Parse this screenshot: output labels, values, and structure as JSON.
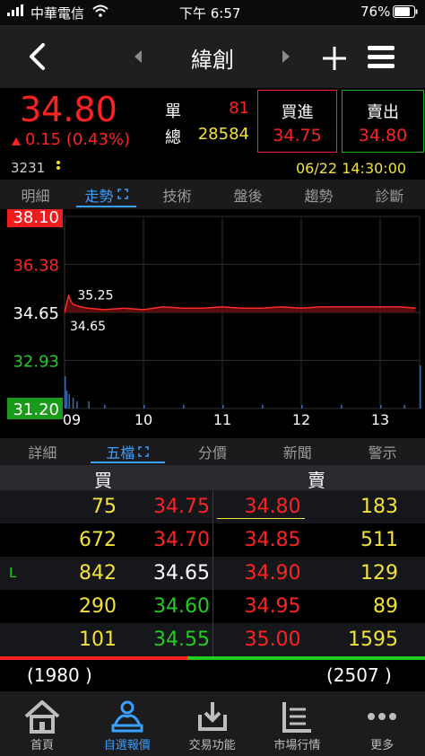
{
  "status_bar": {
    "carrier": "中華電信",
    "time": "下午 6:57",
    "battery": "76%"
  },
  "nav": {
    "title": "緯創",
    "back_icon": "chevron-left-icon",
    "prev_icon": "caret-left-icon",
    "next_icon": "caret-right-icon",
    "add_icon": "plus-icon",
    "menu_icon": "hamburger-icon"
  },
  "quote": {
    "price": "34.80",
    "change": "0.15 (0.43%)",
    "code": "3231",
    "single_label": "單",
    "single_value": "81",
    "total_label": "總",
    "total_value": "28584",
    "buy_label": "買進",
    "buy_price": "34.75",
    "sell_label": "賣出",
    "sell_price": "34.80",
    "datetime": "06/22 14:30:00"
  },
  "top_tabs": [
    "明細",
    "走勢",
    "技術",
    "盤後",
    "趨勢",
    "診斷"
  ],
  "top_tabs_active": 1,
  "chart_data": {
    "type": "line",
    "y_ticks": [
      "38.10",
      "36.38",
      "34.65",
      "32.93",
      "31.20"
    ],
    "ylim": [
      31.2,
      38.1
    ],
    "reference": 34.65,
    "x_ticks": [
      "09",
      "10",
      "11",
      "12",
      "13"
    ],
    "x_range_hours": [
      9,
      13.5
    ],
    "annotations": {
      "high": "35.25",
      "low": "34.65"
    },
    "series": [
      {
        "x": [
          9.0,
          9.05,
          9.1,
          9.2,
          9.3,
          9.5,
          9.75,
          10.0,
          10.25,
          10.5,
          10.75,
          11.0,
          11.25,
          11.5,
          11.75,
          12.0,
          12.25,
          12.5,
          12.75,
          13.0,
          13.25,
          13.45
        ],
        "values": [
          34.65,
          35.25,
          34.95,
          34.85,
          34.8,
          34.75,
          34.8,
          34.75,
          34.85,
          34.8,
          34.8,
          34.85,
          34.8,
          34.8,
          34.85,
          34.8,
          34.85,
          34.85,
          34.85,
          34.85,
          34.85,
          34.8
        ]
      }
    ],
    "volume_x": [
      9.0,
      9.02,
      9.05,
      9.1,
      9.15,
      9.3,
      9.5,
      10.0,
      10.5,
      11.0,
      11.5,
      12.0,
      12.5,
      13.0,
      13.3,
      13.5
    ],
    "volume": [
      9,
      5,
      4,
      3,
      2,
      2,
      1,
      1,
      1,
      1,
      1,
      1,
      1,
      1,
      1,
      12
    ],
    "grid": true
  },
  "sub_tabs": [
    "詳細",
    "五檔",
    "分價",
    "新聞",
    "警示"
  ],
  "sub_tabs_active": 1,
  "order_book": {
    "buy_header": "買",
    "sell_header": "賣",
    "rows": [
      {
        "marker": "",
        "buy_vol": "75",
        "buy_price": "34.75",
        "buy_color": "#ff2222",
        "sell_price": "34.80",
        "sell_color": "#ff2222",
        "sell_vol": "183"
      },
      {
        "marker": "",
        "buy_vol": "672",
        "buy_price": "34.70",
        "buy_color": "#ff2222",
        "sell_price": "34.85",
        "sell_color": "#ff2222",
        "sell_vol": "511"
      },
      {
        "marker": "L",
        "buy_vol": "842",
        "buy_price": "34.65",
        "buy_color": "#ffffff",
        "sell_price": "34.90",
        "sell_color": "#ff2222",
        "sell_vol": "129"
      },
      {
        "marker": "",
        "buy_vol": "290",
        "buy_price": "34.60",
        "buy_color": "#22cc22",
        "sell_price": "34.95",
        "sell_color": "#ff2222",
        "sell_vol": "89"
      },
      {
        "marker": "",
        "buy_vol": "101",
        "buy_price": "34.55",
        "buy_color": "#22cc22",
        "sell_price": "35.00",
        "sell_color": "#ff2222",
        "sell_vol": "1595"
      }
    ],
    "buy_total": "(1980 )",
    "sell_total": "(2507 )",
    "buy_ratio": 0.44
  },
  "bottom_tabs": [
    {
      "label": "首頁",
      "icon": "home-icon"
    },
    {
      "label": "自選報價",
      "icon": "watchlist-icon"
    },
    {
      "label": "交易功能",
      "icon": "trade-download-icon"
    },
    {
      "label": "市場行情",
      "icon": "market-list-icon"
    },
    {
      "label": "更多",
      "icon": "more-dots-icon"
    }
  ],
  "bottom_tabs_active": 1,
  "colors": {
    "up": "#ff2222",
    "down": "#22cc22",
    "accent": "#3aa0ff",
    "volume_yellow": "#f2e23a"
  }
}
